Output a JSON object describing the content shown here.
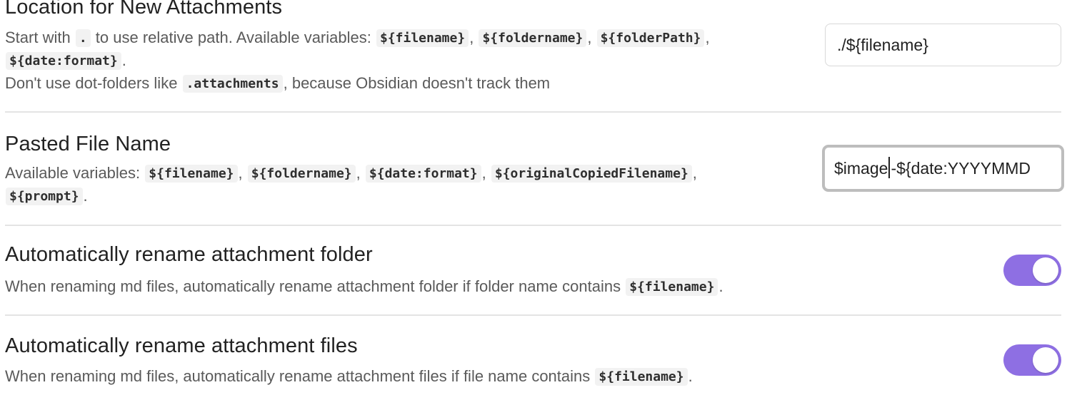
{
  "settings": {
    "location": {
      "name": "Location for New Attachments",
      "desc_1a": "Start with",
      "dot_code": ".",
      "desc_1b": "to use relative path. Available variables:",
      "var_filename": "${filename}",
      "var_foldername": "${foldername}",
      "var_folderpath": "${folderPath}",
      "comma": ",",
      "var_date": "${date:format}",
      "period": ".",
      "desc_3a": "Don't use dot-folders like",
      "attachments_code": ".attachments",
      "desc_3b": ", because Obsidian doesn't track them",
      "input_value": "./${filename}"
    },
    "pasted": {
      "name": "Pasted File Name",
      "desc_1a": "Available variables:",
      "var_filename": "${filename}",
      "var_foldername": "${foldername}",
      "var_date": "${date:format}",
      "var_original": "${originalCopiedFilename}",
      "comma": ",",
      "var_prompt": "${prompt}",
      "period": ".",
      "input_before_caret": "$image",
      "input_after_caret": "-${date:YYYYMMD"
    },
    "rename_folder": {
      "name": "Automatically rename attachment folder",
      "desc_a": "When renaming md files, automatically rename attachment folder if folder name contains",
      "var_filename": "${filename}",
      "period": ".",
      "toggle_on": true
    },
    "rename_files": {
      "name": "Automatically rename attachment files",
      "desc_a": "When renaming md files, automatically rename attachment files if file name contains",
      "var_filename": "${filename}",
      "period": ".",
      "toggle_on": true
    }
  },
  "colors": {
    "toggle_on": "#8e6fe3",
    "divider": "#e4e4e4",
    "focus_border": "#bdbdbd"
  }
}
